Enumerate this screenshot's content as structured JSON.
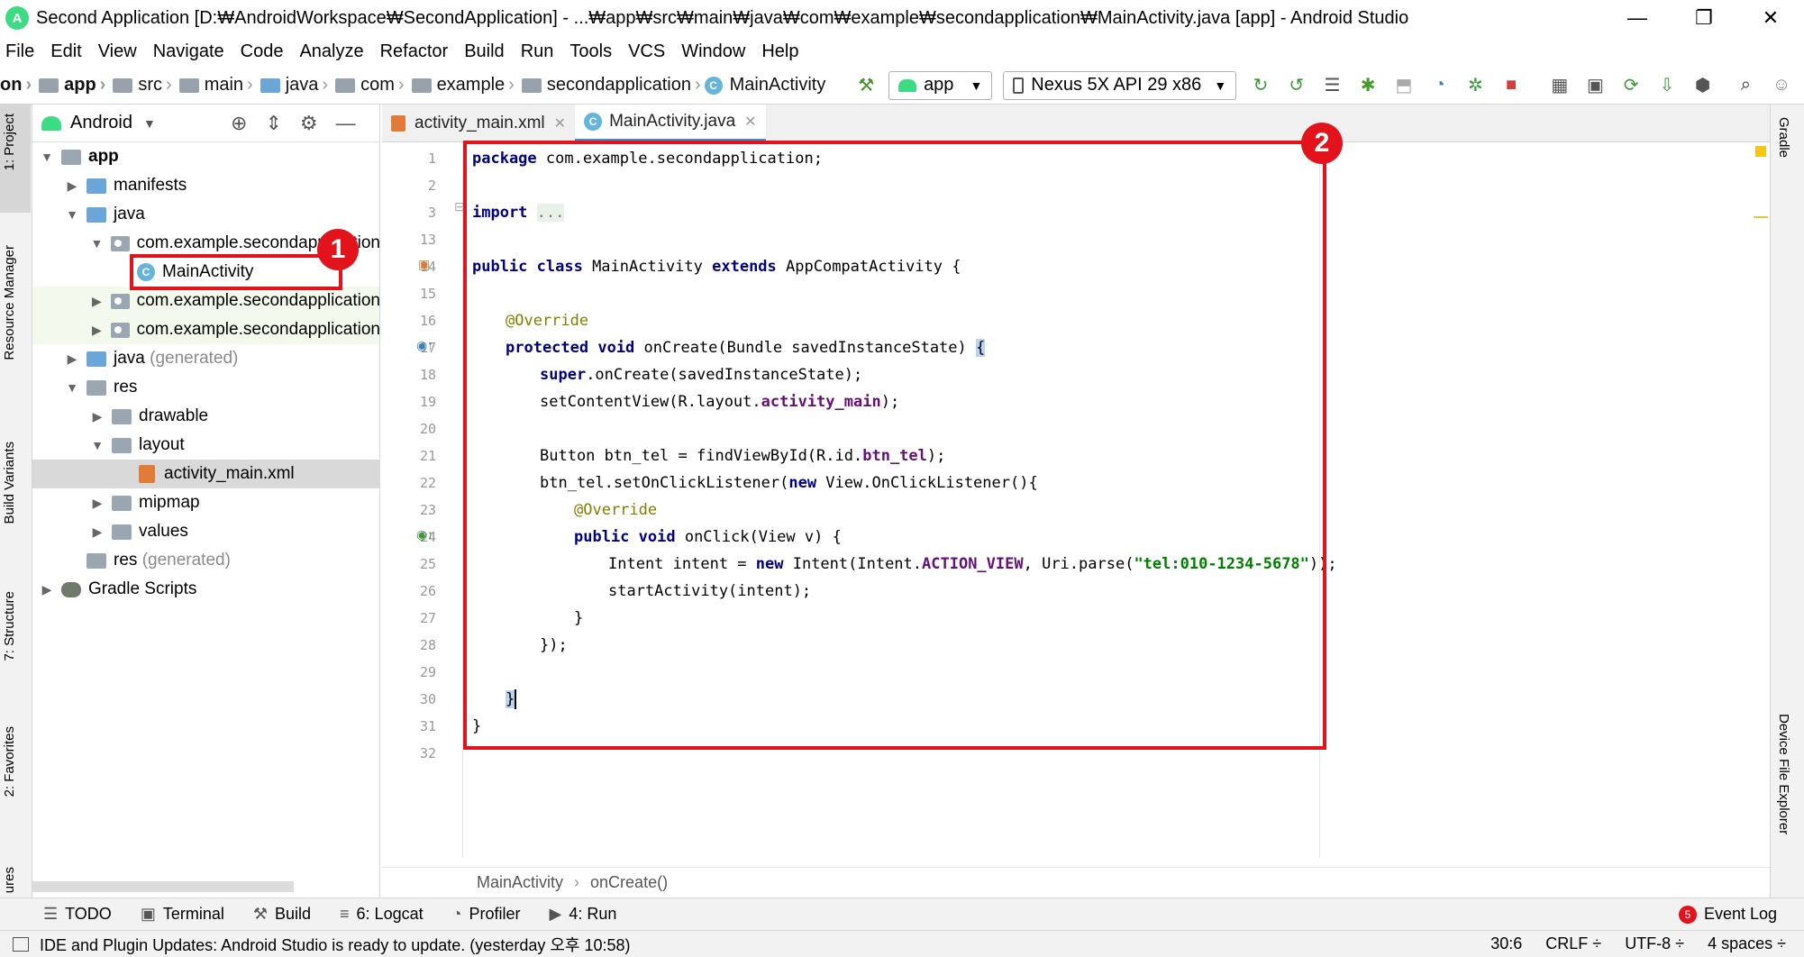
{
  "window": {
    "title": "Second Application [D:₩AndroidWorkspace₩SecondApplication] - ...₩app₩src₩main₩java₩com₩example₩secondapplication₩MainActivity.java [app] - Android Studio",
    "minimize": "—",
    "restore": "❐",
    "close": "✕"
  },
  "menu": [
    "File",
    "Edit",
    "View",
    "Navigate",
    "Code",
    "Analyze",
    "Refactor",
    "Build",
    "Run",
    "Tools",
    "VCS",
    "Window",
    "Help"
  ],
  "breadcrumbs": [
    "on",
    "app",
    "src",
    "main",
    "java",
    "com",
    "example",
    "secondapplication",
    "MainActivity"
  ],
  "toolbar": {
    "run_config": "app",
    "device": "Nexus 5X API 29 x86"
  },
  "project_panel": {
    "view": "Android",
    "tree": [
      {
        "label": "app"
      },
      {
        "label": "manifests"
      },
      {
        "label": "java"
      },
      {
        "label": "com.example.secondapplication"
      },
      {
        "label": "MainActivity"
      },
      {
        "label": "com.example.secondapplication"
      },
      {
        "label": "com.example.secondapplication"
      },
      {
        "label": "java",
        "suffix": "(generated)"
      },
      {
        "label": "res"
      },
      {
        "label": "drawable"
      },
      {
        "label": "layout"
      },
      {
        "label": "activity_main.xml"
      },
      {
        "label": "mipmap"
      },
      {
        "label": "values"
      },
      {
        "label": "res",
        "suffix": "(generated)"
      },
      {
        "label": "Gradle Scripts"
      }
    ]
  },
  "left_tool_windows": [
    "1: Project",
    "Resource Manager",
    "Build Variants",
    "7: Structure",
    "2: Favorites",
    "ures"
  ],
  "right_tool_windows": [
    "Gradle",
    "Device File Explorer"
  ],
  "tabs": [
    {
      "label": "activity_main.xml"
    },
    {
      "label": "MainActivity.java"
    }
  ],
  "line_numbers": [
    "1",
    "2",
    "3",
    "13",
    "14",
    "15",
    "16",
    "17",
    "18",
    "19",
    "20",
    "21",
    "22",
    "23",
    "24",
    "25",
    "26",
    "27",
    "28",
    "29",
    "30",
    "31",
    "32"
  ],
  "code": {
    "l1_kw": "package",
    "l1_rest": " com.example.secondapplication;",
    "l3_kw": "import",
    "l3_fold": "...",
    "l14_a": "public class",
    "l14_b": " MainActivity ",
    "l14_c": "extends",
    "l14_d": " AppCompatActivity {",
    "l16": "@Override",
    "l17_a": "protected void",
    "l17_b": " onCreate(Bundle savedInstanceState) ",
    "l17_brace": "{",
    "l18_a": "super",
    "l18_b": ".onCreate(savedInstanceState);",
    "l19_a": "setContentView(R.layout.",
    "l19_b": "activity_main",
    "l19_c": ");",
    "l21_a": "Button btn_tel = findViewById(R.id.",
    "l21_b": "btn_tel",
    "l21_c": ");",
    "l22_a": "btn_tel.setOnClickListener(",
    "l22_b": "new",
    "l22_c": " View.OnClickListener(){",
    "l23": "@Override",
    "l24_a": "public void",
    "l24_b": " onClick(View v) {",
    "l25_a": "Intent intent = ",
    "l25_b": "new",
    "l25_c": " Intent(Intent.",
    "l25_d": "ACTION_VIEW",
    "l25_e": ", Uri.parse(",
    "l25_f": "\"tel:010-1234-5678\"",
    "l25_g": "));",
    "l26": "startActivity(intent);",
    "l27": "}",
    "l28": "});",
    "l30": "}",
    "l31": "}"
  },
  "markers": {
    "one": "1",
    "two": "2"
  },
  "editor_breadcrumb": [
    "MainActivity",
    "onCreate()"
  ],
  "bottom_tools": [
    {
      "label": "TODO",
      "icon": "list-icon"
    },
    {
      "label": "Terminal",
      "icon": "terminal-icon"
    },
    {
      "label": "Build",
      "icon": "hammer-icon"
    },
    {
      "label": "6: Logcat",
      "icon": "logcat-icon"
    },
    {
      "label": "Profiler",
      "icon": "gauge-icon"
    },
    {
      "label": "4: Run",
      "icon": "play-icon"
    }
  ],
  "event_log": {
    "count": "5",
    "label": "Event Log"
  },
  "status": {
    "message": "IDE and Plugin Updates: Android Studio is ready to update. (yesterday 오후 10:58)",
    "position": "30:6",
    "line_sep": "CRLF ÷",
    "encoding": "UTF-8 ÷",
    "indent": "4 spaces ÷"
  },
  "colors": {
    "marker": "#e3131b",
    "keyword": "#000080",
    "annotation": "#808000",
    "string": "#008000",
    "field": "#660e7a"
  }
}
